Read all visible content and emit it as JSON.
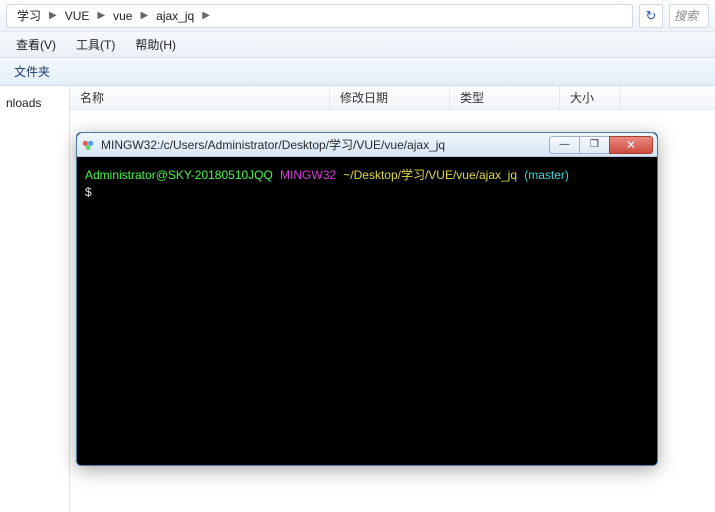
{
  "breadcrumb": {
    "items": [
      "学习",
      "VUE",
      "vue",
      "ajax_jq"
    ],
    "search_placeholder": "搜索"
  },
  "menu": {
    "view": "查看(V)",
    "tools": "工具(T)",
    "help": "帮助(H)"
  },
  "toolbar": {
    "folder_label": "文件夹"
  },
  "nav": {
    "items": [
      "nloads"
    ]
  },
  "columns": {
    "name": "名称",
    "modified": "修改日期",
    "type": "类型",
    "size": "大小"
  },
  "terminal": {
    "title": "MINGW32:/c/Users/Administrator/Desktop/学习/VUE/vue/ajax_jq",
    "prompt": {
      "user_host": "Administrator@SKY-20180510JQQ",
      "shell": "MINGW32",
      "path": "~/Desktop/学习/VUE/vue/ajax_jq",
      "branch": "(master)",
      "symbol": "$"
    },
    "win_btn_labels": {
      "min": "—",
      "max": "❐",
      "close": "✕"
    }
  }
}
